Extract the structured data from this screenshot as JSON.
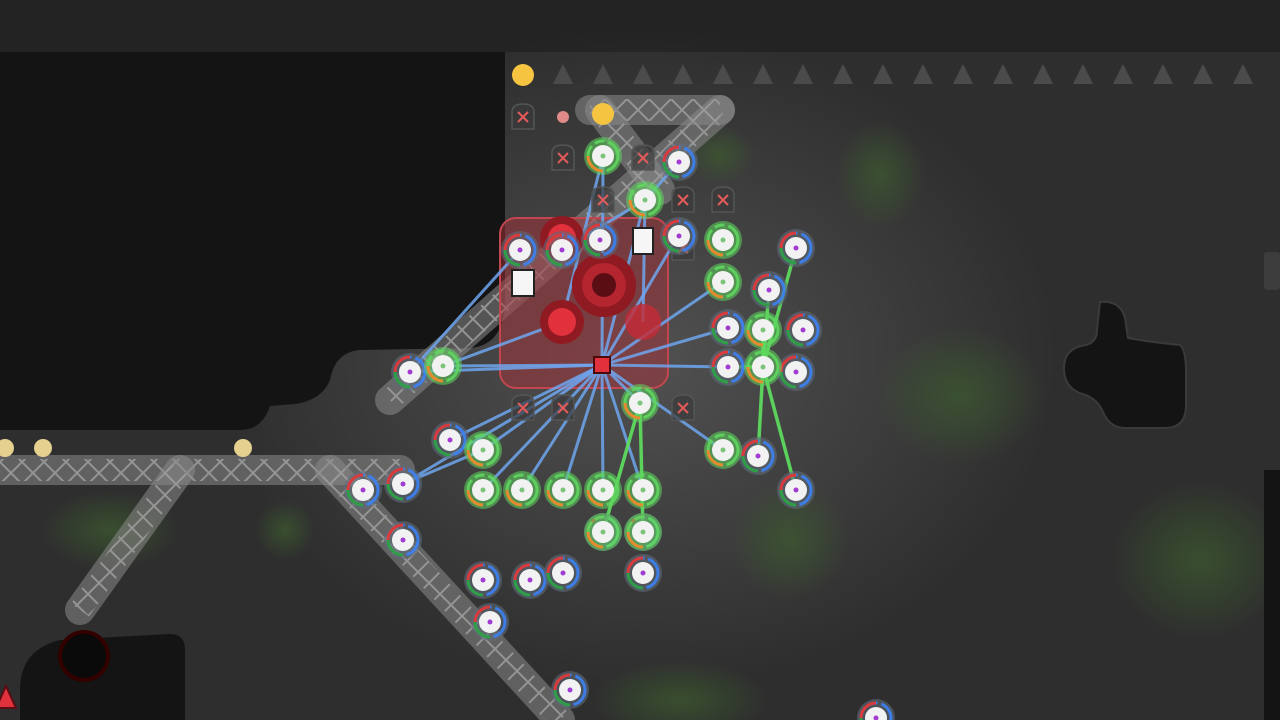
{
  "scene": {
    "type": "top-down-network-game",
    "colors": {
      "background": "#2e2e2e",
      "top_bar": "#232323",
      "void": "#141414",
      "truss": "#8a8a8a",
      "link_blue": "#6fa6ee",
      "link_green": "#5ee05e",
      "node_white": "#f2f2f2",
      "node_ring": "#5f6a78",
      "node_active_ring": "#5fd65f",
      "core_red": "#e0313d",
      "core_dark_red": "#8f1a22",
      "core_zone": "#a8323a",
      "spike": "#4b4b4b",
      "coin_yellow": "#f5c542",
      "coin_pale": "#e6d08f",
      "disabled_tag": "#e35a5a",
      "moss": "#3c5a2f"
    },
    "hub": {
      "label": "",
      "state": "active"
    },
    "nodes": {
      "total_visible": 44,
      "active_green": 17,
      "idle_ringed": 27
    },
    "links": {
      "blue_count": 25,
      "green_count": 8
    },
    "disabled_sockets": 10,
    "coins": {
      "yellow": 3,
      "pale": 3
    },
    "spikes": 18,
    "icons": [
      "hub-icon",
      "node-icon",
      "link-icon",
      "spike-icon",
      "coin-icon",
      "disabled-socket-icon",
      "truss-icon",
      "core-icon"
    ]
  }
}
